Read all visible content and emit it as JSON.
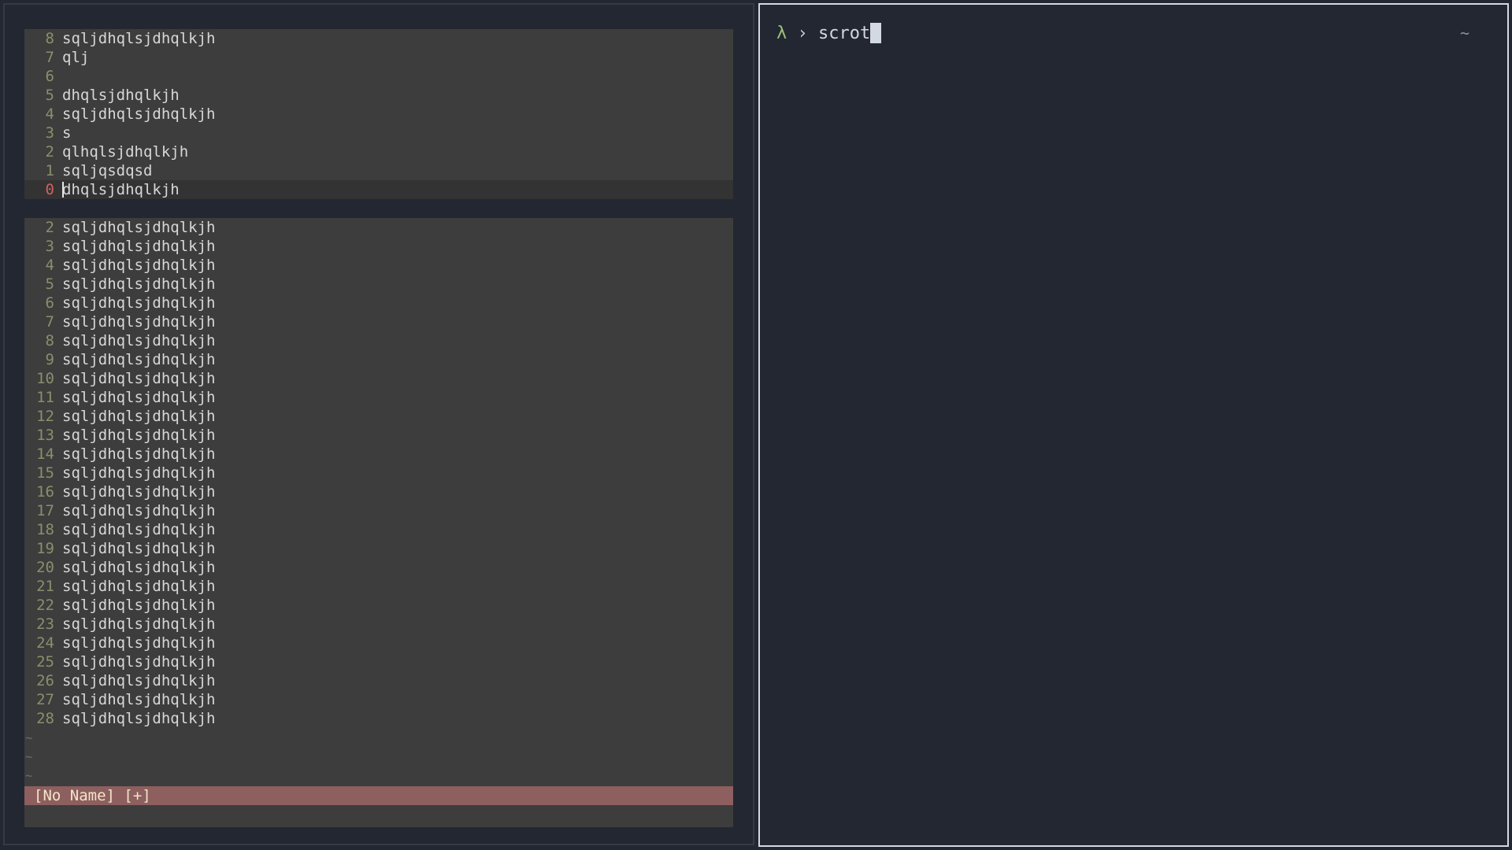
{
  "editor": {
    "top_lines": [
      {
        "num": "8",
        "text": "sqljdhqlsjdhqlkjh"
      },
      {
        "num": "7",
        "text": "qlj"
      },
      {
        "num": "6",
        "text": ""
      },
      {
        "num": "5",
        "text": "dhqlsjdhqlkjh"
      },
      {
        "num": "4",
        "text": "sqljdhqlsjdhqlkjh"
      },
      {
        "num": "3",
        "text": "s"
      },
      {
        "num": "2",
        "text": "qlhqlsjdhqlkjh"
      },
      {
        "num": "1",
        "text": "sqljqsdqsd"
      },
      {
        "num": "0",
        "text": "dhqlsjdhqlkjh",
        "current": true
      }
    ],
    "bottom_lines": [
      {
        "num": "2",
        "text": "sqljdhqlsjdhqlkjh"
      },
      {
        "num": "3",
        "text": "sqljdhqlsjdhqlkjh"
      },
      {
        "num": "4",
        "text": "sqljdhqlsjdhqlkjh"
      },
      {
        "num": "5",
        "text": "sqljdhqlsjdhqlkjh"
      },
      {
        "num": "6",
        "text": "sqljdhqlsjdhqlkjh"
      },
      {
        "num": "7",
        "text": "sqljdhqlsjdhqlkjh"
      },
      {
        "num": "8",
        "text": "sqljdhqlsjdhqlkjh"
      },
      {
        "num": "9",
        "text": "sqljdhqlsjdhqlkjh"
      },
      {
        "num": "10",
        "text": "sqljdhqlsjdhqlkjh"
      },
      {
        "num": "11",
        "text": "sqljdhqlsjdhqlkjh"
      },
      {
        "num": "12",
        "text": "sqljdhqlsjdhqlkjh"
      },
      {
        "num": "13",
        "text": "sqljdhqlsjdhqlkjh"
      },
      {
        "num": "14",
        "text": "sqljdhqlsjdhqlkjh"
      },
      {
        "num": "15",
        "text": "sqljdhqlsjdhqlkjh"
      },
      {
        "num": "16",
        "text": "sqljdhqlsjdhqlkjh"
      },
      {
        "num": "17",
        "text": "sqljdhqlsjdhqlkjh"
      },
      {
        "num": "18",
        "text": "sqljdhqlsjdhqlkjh"
      },
      {
        "num": "19",
        "text": "sqljdhqlsjdhqlkjh"
      },
      {
        "num": "20",
        "text": "sqljdhqlsjdhqlkjh"
      },
      {
        "num": "21",
        "text": "sqljdhqlsjdhqlkjh"
      },
      {
        "num": "22",
        "text": "sqljdhqlsjdhqlkjh"
      },
      {
        "num": "23",
        "text": "sqljdhqlsjdhqlkjh"
      },
      {
        "num": "24",
        "text": "sqljdhqlsjdhqlkjh"
      },
      {
        "num": "25",
        "text": "sqljdhqlsjdhqlkjh"
      },
      {
        "num": "26",
        "text": "sqljdhqlsjdhqlkjh"
      },
      {
        "num": "27",
        "text": "sqljdhqlsjdhqlkjh"
      },
      {
        "num": "28",
        "text": "sqljdhqlsjdhqlkjh"
      }
    ],
    "empty_marker": "~",
    "statusline": "[No Name] [+]",
    "colors": {
      "line_number": "#8a8f6a",
      "current_line_number": "#d45f5f",
      "statusline_bg": "#8d5f5f"
    }
  },
  "terminal": {
    "prompt_symbol": "λ",
    "prompt_chevron": "›",
    "command": "scrot",
    "right_prompt": "~",
    "colors": {
      "prompt_symbol": "#9ec079",
      "border_focused": "#d3d9e3"
    }
  }
}
